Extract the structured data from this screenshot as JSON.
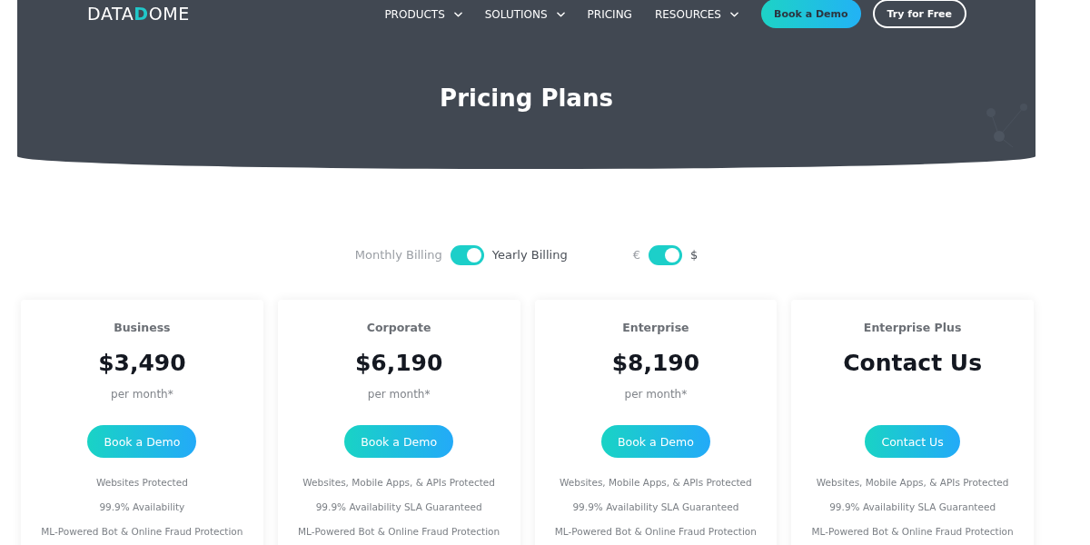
{
  "header": {
    "logo": [
      {
        "text": "DATA",
        "accent": false
      },
      {
        "text": "D",
        "accent": true
      },
      {
        "text": "OME",
        "accent": false
      }
    ],
    "nav": [
      {
        "label": "PRODUCTS",
        "dropdown": true
      },
      {
        "label": "SOLUTIONS",
        "dropdown": true
      },
      {
        "label": "PRICING",
        "dropdown": false
      },
      {
        "label": "RESOURCES",
        "dropdown": true
      }
    ],
    "buttons": [
      {
        "label": "Book a Demo",
        "kind": "filled"
      },
      {
        "label": "Try for Free",
        "kind": "outline"
      }
    ]
  },
  "hero": {
    "title": "Pricing Plans"
  },
  "toggles": [
    {
      "off_label": "Monthly Billing",
      "on_label": "Yearly Billing",
      "on": true
    },
    {
      "off_label": "€",
      "on_label": "$",
      "on": true
    }
  ],
  "plans": [
    {
      "name": "Business",
      "price": "$3,490",
      "period": "per month*",
      "button": "Book a Demo",
      "features": [
        "Websites Protected",
        "99.9% Availability",
        "ML-Powered Bot & Online Fraud Protection"
      ]
    },
    {
      "name": "Corporate",
      "price": "$6,190",
      "period": "per month*",
      "button": "Book a Demo",
      "features": [
        "Websites, Mobile Apps, & APIs Protected",
        "99.9% Availability SLA Guaranteed",
        "ML-Powered Bot & Online Fraud Protection"
      ]
    },
    {
      "name": "Enterprise",
      "price": "$8,190",
      "period": "per month*",
      "button": "Book a Demo",
      "features": [
        "Websites, Mobile Apps, & APIs Protected",
        "99.9% Availability SLA Guaranteed",
        "ML-Powered Bot & Online Fraud Protection"
      ]
    },
    {
      "name": "Enterprise Plus",
      "price": "Contact Us",
      "button": "Contact Us",
      "features": [
        "Websites, Mobile Apps, & APIs Protected",
        "99.9% Availability SLA Guaranteed",
        "ML-Powered Bot & Online Fraud Protection"
      ]
    }
  ]
}
